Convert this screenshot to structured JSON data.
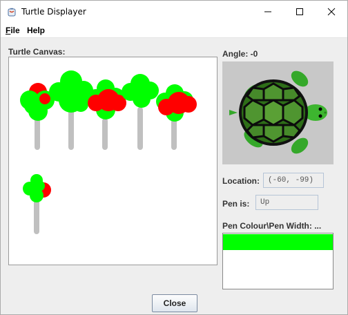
{
  "window": {
    "title": "Turtle Displayer",
    "icons": {
      "app": "java-cup-icon",
      "minimize": "minimize-icon",
      "maximize": "maximize-icon",
      "close": "close-icon"
    }
  },
  "menu": {
    "file": {
      "mnemonic": "F",
      "rest": "ile"
    },
    "help": "Help"
  },
  "canvas": {
    "label": "Turtle Canvas:"
  },
  "angle": {
    "label": "Angle: -0"
  },
  "location": {
    "label": "Location:",
    "value": "(-60, -99)"
  },
  "pen": {
    "label": "Pen is:",
    "value": "Up"
  },
  "pen_colour": {
    "label": "Pen Colour\\Pen Width: ...",
    "color": "#00ff00"
  },
  "buttons": {
    "close": "Close"
  },
  "colors": {
    "leaf_green": "#00ff00",
    "leaf_red": "#ff0000",
    "trunk_gray": "#c0c0c0",
    "turtle_bg": "#c8c8c8"
  }
}
